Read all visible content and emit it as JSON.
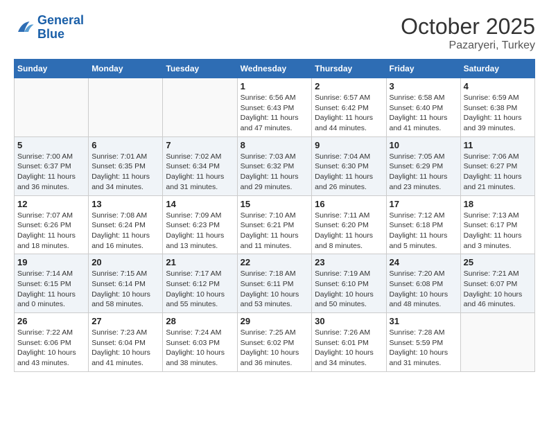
{
  "header": {
    "logo_line1": "General",
    "logo_line2": "Blue",
    "month": "October 2025",
    "location": "Pazaryeri, Turkey"
  },
  "weekdays": [
    "Sunday",
    "Monday",
    "Tuesday",
    "Wednesday",
    "Thursday",
    "Friday",
    "Saturday"
  ],
  "weeks": [
    [
      {
        "day": "",
        "info": ""
      },
      {
        "day": "",
        "info": ""
      },
      {
        "day": "",
        "info": ""
      },
      {
        "day": "1",
        "info": "Sunrise: 6:56 AM\nSunset: 6:43 PM\nDaylight: 11 hours\nand 47 minutes."
      },
      {
        "day": "2",
        "info": "Sunrise: 6:57 AM\nSunset: 6:42 PM\nDaylight: 11 hours\nand 44 minutes."
      },
      {
        "day": "3",
        "info": "Sunrise: 6:58 AM\nSunset: 6:40 PM\nDaylight: 11 hours\nand 41 minutes."
      },
      {
        "day": "4",
        "info": "Sunrise: 6:59 AM\nSunset: 6:38 PM\nDaylight: 11 hours\nand 39 minutes."
      }
    ],
    [
      {
        "day": "5",
        "info": "Sunrise: 7:00 AM\nSunset: 6:37 PM\nDaylight: 11 hours\nand 36 minutes."
      },
      {
        "day": "6",
        "info": "Sunrise: 7:01 AM\nSunset: 6:35 PM\nDaylight: 11 hours\nand 34 minutes."
      },
      {
        "day": "7",
        "info": "Sunrise: 7:02 AM\nSunset: 6:34 PM\nDaylight: 11 hours\nand 31 minutes."
      },
      {
        "day": "8",
        "info": "Sunrise: 7:03 AM\nSunset: 6:32 PM\nDaylight: 11 hours\nand 29 minutes."
      },
      {
        "day": "9",
        "info": "Sunrise: 7:04 AM\nSunset: 6:30 PM\nDaylight: 11 hours\nand 26 minutes."
      },
      {
        "day": "10",
        "info": "Sunrise: 7:05 AM\nSunset: 6:29 PM\nDaylight: 11 hours\nand 23 minutes."
      },
      {
        "day": "11",
        "info": "Sunrise: 7:06 AM\nSunset: 6:27 PM\nDaylight: 11 hours\nand 21 minutes."
      }
    ],
    [
      {
        "day": "12",
        "info": "Sunrise: 7:07 AM\nSunset: 6:26 PM\nDaylight: 11 hours\nand 18 minutes."
      },
      {
        "day": "13",
        "info": "Sunrise: 7:08 AM\nSunset: 6:24 PM\nDaylight: 11 hours\nand 16 minutes."
      },
      {
        "day": "14",
        "info": "Sunrise: 7:09 AM\nSunset: 6:23 PM\nDaylight: 11 hours\nand 13 minutes."
      },
      {
        "day": "15",
        "info": "Sunrise: 7:10 AM\nSunset: 6:21 PM\nDaylight: 11 hours\nand 11 minutes."
      },
      {
        "day": "16",
        "info": "Sunrise: 7:11 AM\nSunset: 6:20 PM\nDaylight: 11 hours\nand 8 minutes."
      },
      {
        "day": "17",
        "info": "Sunrise: 7:12 AM\nSunset: 6:18 PM\nDaylight: 11 hours\nand 5 minutes."
      },
      {
        "day": "18",
        "info": "Sunrise: 7:13 AM\nSunset: 6:17 PM\nDaylight: 11 hours\nand 3 minutes."
      }
    ],
    [
      {
        "day": "19",
        "info": "Sunrise: 7:14 AM\nSunset: 6:15 PM\nDaylight: 11 hours\nand 0 minutes."
      },
      {
        "day": "20",
        "info": "Sunrise: 7:15 AM\nSunset: 6:14 PM\nDaylight: 10 hours\nand 58 minutes."
      },
      {
        "day": "21",
        "info": "Sunrise: 7:17 AM\nSunset: 6:12 PM\nDaylight: 10 hours\nand 55 minutes."
      },
      {
        "day": "22",
        "info": "Sunrise: 7:18 AM\nSunset: 6:11 PM\nDaylight: 10 hours\nand 53 minutes."
      },
      {
        "day": "23",
        "info": "Sunrise: 7:19 AM\nSunset: 6:10 PM\nDaylight: 10 hours\nand 50 minutes."
      },
      {
        "day": "24",
        "info": "Sunrise: 7:20 AM\nSunset: 6:08 PM\nDaylight: 10 hours\nand 48 minutes."
      },
      {
        "day": "25",
        "info": "Sunrise: 7:21 AM\nSunset: 6:07 PM\nDaylight: 10 hours\nand 46 minutes."
      }
    ],
    [
      {
        "day": "26",
        "info": "Sunrise: 7:22 AM\nSunset: 6:06 PM\nDaylight: 10 hours\nand 43 minutes."
      },
      {
        "day": "27",
        "info": "Sunrise: 7:23 AM\nSunset: 6:04 PM\nDaylight: 10 hours\nand 41 minutes."
      },
      {
        "day": "28",
        "info": "Sunrise: 7:24 AM\nSunset: 6:03 PM\nDaylight: 10 hours\nand 38 minutes."
      },
      {
        "day": "29",
        "info": "Sunrise: 7:25 AM\nSunset: 6:02 PM\nDaylight: 10 hours\nand 36 minutes."
      },
      {
        "day": "30",
        "info": "Sunrise: 7:26 AM\nSunset: 6:01 PM\nDaylight: 10 hours\nand 34 minutes."
      },
      {
        "day": "31",
        "info": "Sunrise: 7:28 AM\nSunset: 5:59 PM\nDaylight: 10 hours\nand 31 minutes."
      },
      {
        "day": "",
        "info": ""
      }
    ]
  ]
}
